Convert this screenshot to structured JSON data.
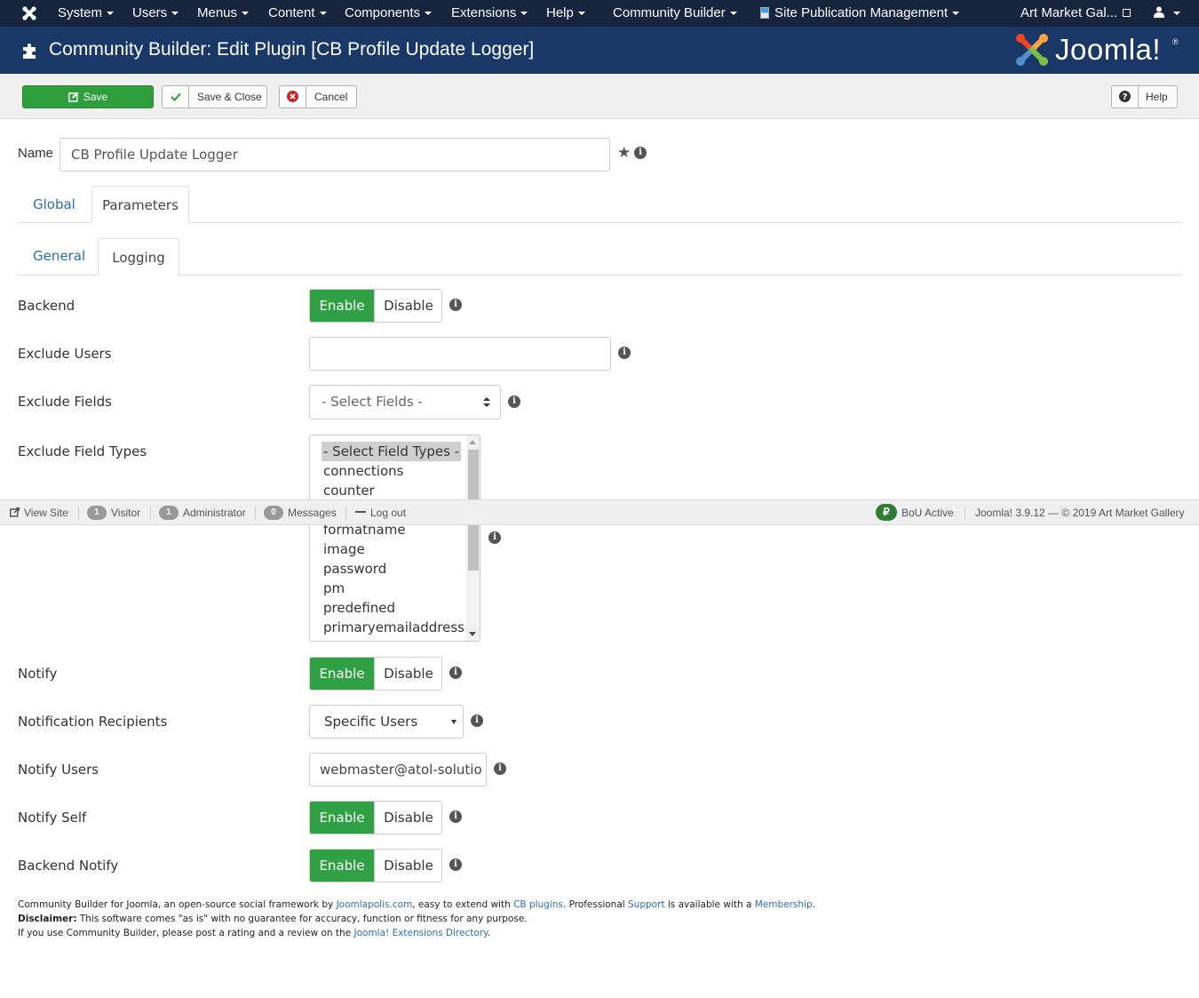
{
  "navbar": {
    "menu": [
      "System",
      "Users",
      "Menus",
      "Content",
      "Components",
      "Extensions",
      "Help"
    ],
    "community_builder": "Community Builder",
    "site_pub": "Site Publication Management",
    "site_name": "Art Market Gal..."
  },
  "header": {
    "title": "Community Builder: Edit Plugin [CB Profile Update Logger]",
    "logo_text": "Joomla!"
  },
  "toolbar": {
    "save": "Save",
    "save_close": "Save & Close",
    "cancel": "Cancel",
    "help": "Help"
  },
  "name_field": {
    "label": "Name",
    "value": "CB Profile Update Logger"
  },
  "tabs": {
    "main": [
      "Global",
      "Parameters"
    ],
    "sub": [
      "General",
      "Logging"
    ]
  },
  "form": {
    "toggle_enable": "Enable",
    "toggle_disable": "Disable",
    "backend_label": "Backend",
    "exclude_users_label": "Exclude Users",
    "exclude_users_value": "",
    "exclude_fields_label": "Exclude Fields",
    "exclude_fields_select": "- Select Fields -",
    "exclude_field_types_label": "Exclude Field Types",
    "field_types": [
      "- Select Field Types -",
      "connections",
      "counter",
      "formatname",
      "image",
      "password",
      "pm",
      "predefined",
      "primaryemailaddress"
    ],
    "notify_label": "Notify",
    "notification_recipients_label": "Notification Recipients",
    "notification_recipients_value": "Specific Users",
    "notify_users_label": "Notify Users",
    "notify_users_value": "webmaster@atol-solutio",
    "notify_self_label": "Notify Self",
    "backend_notify_label": "Backend Notify"
  },
  "status": {
    "view_site": "View Site",
    "visitor_count": "1",
    "visitor_label": "Visitor",
    "admin_count": "1",
    "admin_label": "Administrator",
    "messages_count": "0",
    "messages_label": "Messages",
    "logout": "Log out",
    "bou": "BoU Active",
    "version": "Joomla! 3.9.12",
    "dash": "—",
    "copyright": "© 2019 Art Market Gallery"
  },
  "footer": {
    "l1_a": "Community Builder for Joomla, an open-source social framework by ",
    "l1_link1": "Joomlapolis.com",
    "l1_b": ", easy to extend with ",
    "l1_link2": "CB plugins",
    "l1_c": ". Professional ",
    "l1_link3": "Support",
    "l1_d": " is available with a ",
    "l1_link4": "Membership",
    "l1_e": ".",
    "l2_bold": "Disclaimer:",
    "l2_text": " This software comes \"as is\" with no guarantee for accuracy, function or fitness for any purpose.",
    "l3_text": "If you use Community Builder, please post a rating and a review on the ",
    "l3_link": "Joomla! Extensions Directory",
    "l3_end": "."
  },
  "colors": {
    "navbar_bg": "#17243d",
    "header_bg": "#1a3867",
    "success": "#2fa043",
    "link": "#2a6fb0"
  },
  "icons": [
    "joomla-icon",
    "puzzle-icon",
    "edit-icon",
    "check-icon",
    "cancel-icon",
    "help-icon",
    "star-icon",
    "info-icon",
    "user-icon",
    "external-link-icon"
  ]
}
